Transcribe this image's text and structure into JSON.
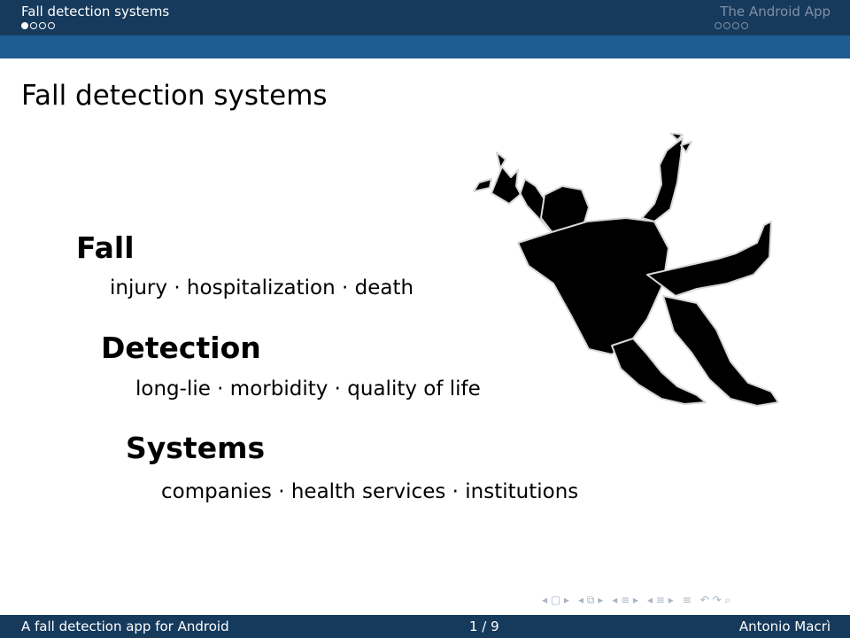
{
  "header": {
    "left_section": "Fall detection systems",
    "right_section": "The Android App",
    "left_dots": [
      true,
      false,
      false,
      false
    ],
    "right_dots": [
      false,
      false,
      false,
      false
    ]
  },
  "slide": {
    "title": "Fall detection systems",
    "items": [
      {
        "title": "Fall",
        "subtitle": "injury · hospitalization · death"
      },
      {
        "title": "Detection",
        "subtitle": "long-lie · morbidity · quality of life"
      },
      {
        "title": "Systems",
        "subtitle": "companies · health services · institutions"
      }
    ]
  },
  "navigation": {
    "icons": [
      "nav-frame-icon",
      "nav-subsection-icon",
      "nav-section-icon",
      "nav-doc-icon",
      "nav-align-icon",
      "nav-search-icon"
    ]
  },
  "footer": {
    "left": "A fall detection app for Android",
    "page": "1 / 9",
    "author": "Antonio Macrì"
  },
  "colors": {
    "headline": "#163a5c",
    "subband": "#1f5c94",
    "inactive_text": "#7f8fa3"
  }
}
